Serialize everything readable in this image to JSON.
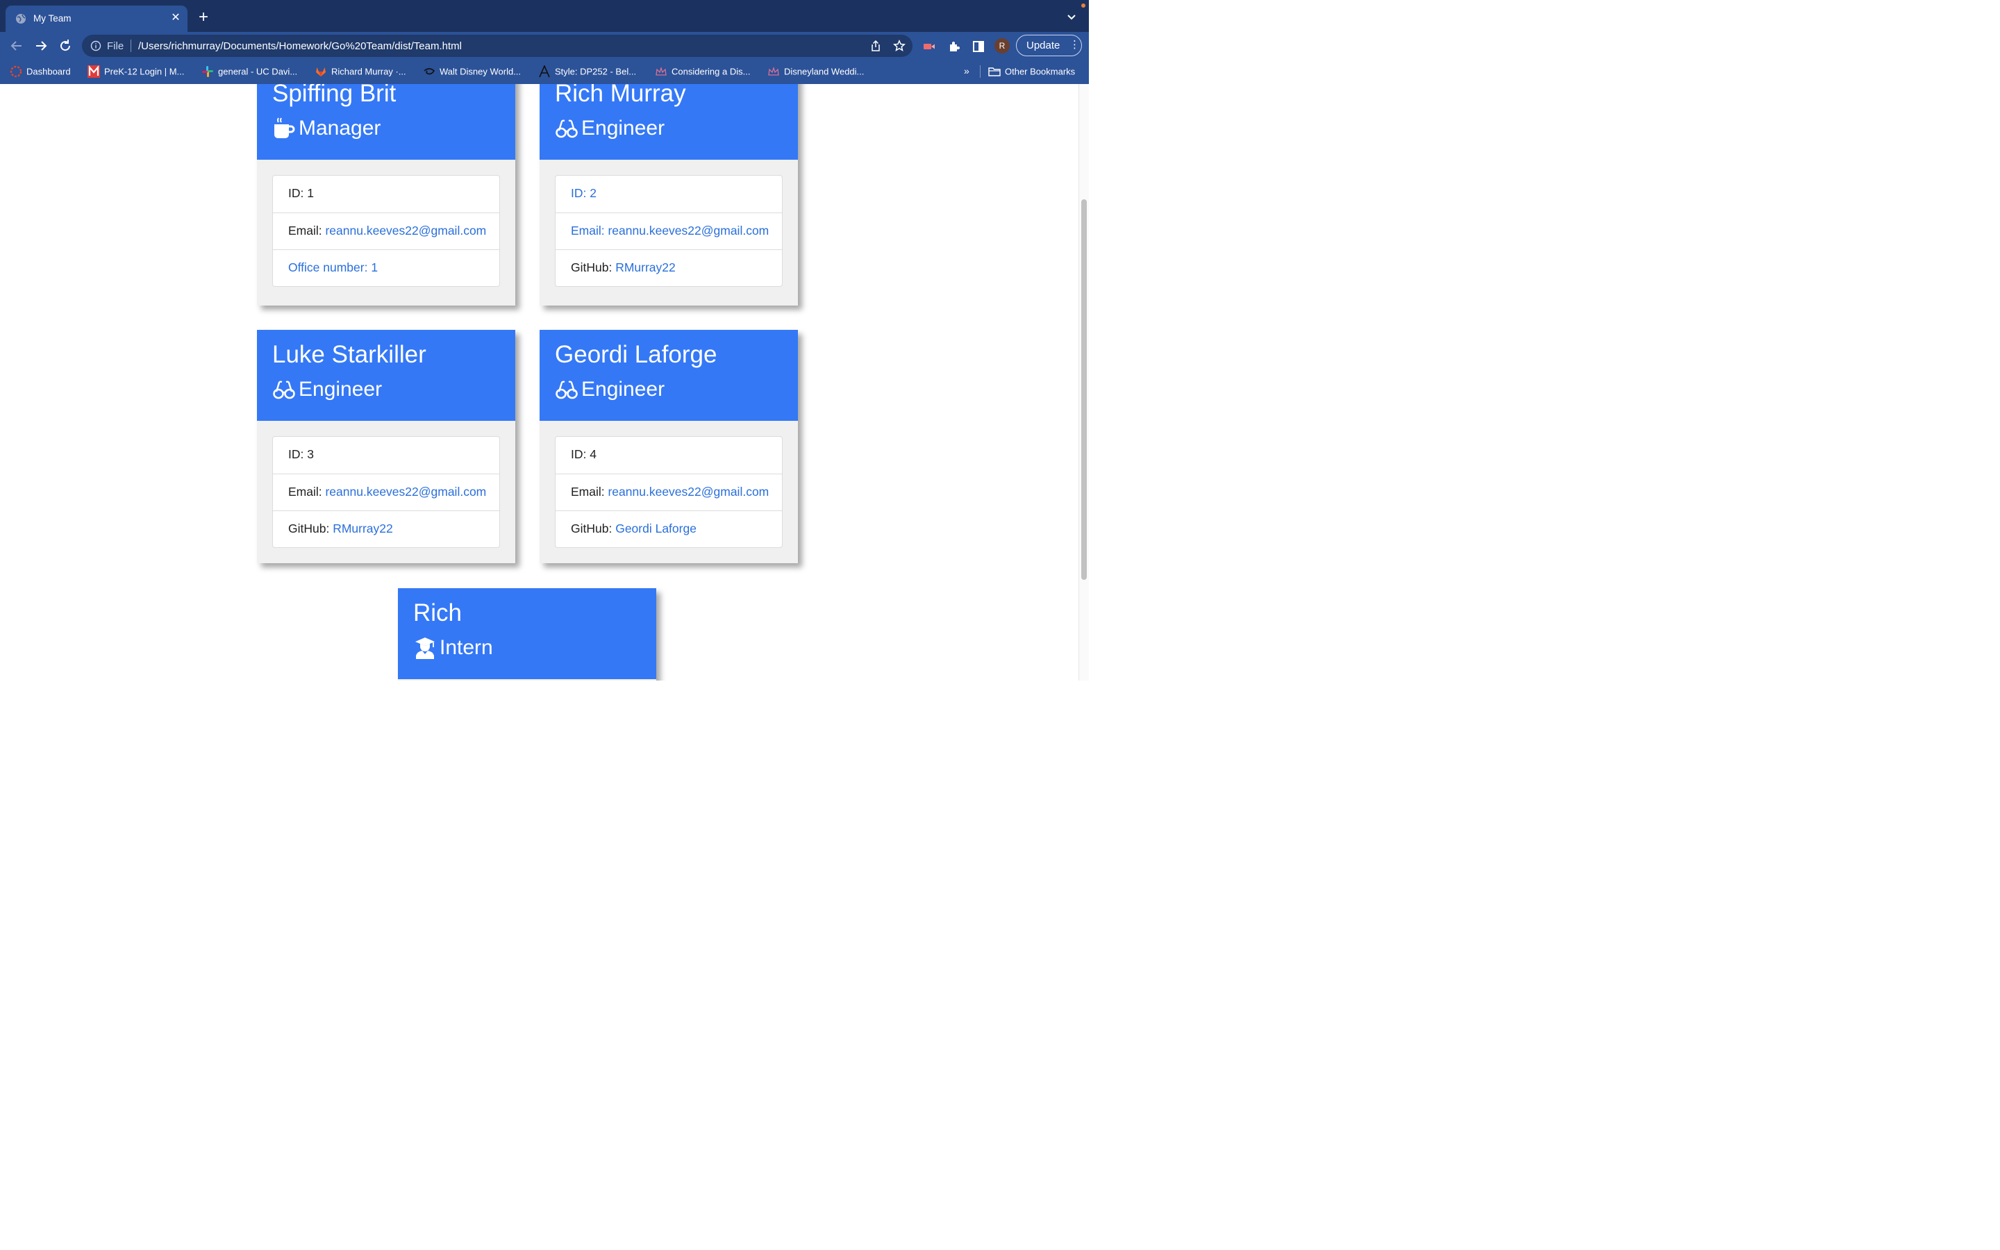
{
  "browser": {
    "tab_title": "My Team",
    "omnibox_scheme": "File",
    "url": "/Users/richmurray/Documents/Homework/Go%20Team/dist/Team.html",
    "profile_initial": "R",
    "update_label": "Update",
    "bookmarks": [
      {
        "label": "Dashboard",
        "icon": "canvas-icon"
      },
      {
        "label": "PreK-12 Login | M...",
        "icon": "m-logo-icon"
      },
      {
        "label": "general - UC Davi...",
        "icon": "slack-icon"
      },
      {
        "label": "Richard Murray ·...",
        "icon": "gitlab-icon"
      },
      {
        "label": "Walt Disney World...",
        "icon": "disney-icon"
      },
      {
        "label": "Style: DP252 - Bel...",
        "icon": "font-a-icon"
      },
      {
        "label": "Considering a Dis...",
        "icon": "crown-icon"
      },
      {
        "label": "Disneyland Weddi...",
        "icon": "crown-icon"
      }
    ],
    "bookmarks_more": "»",
    "other_bookmarks": "Other Bookmarks"
  },
  "team": [
    {
      "name": "Spiffing Brit",
      "role": "Manager",
      "role_icon": "coffee-mug-icon",
      "id_label": "ID: 1",
      "email_key": "Email: ",
      "email": "reannu.keeves22@gmail.com",
      "extra_label": "Office number: 1"
    },
    {
      "name": "Rich Murray",
      "role": "Engineer",
      "role_icon": "glasses-icon",
      "id_label": "ID: 2",
      "email_label": "Email: reannu.keeves22@gmail.com",
      "extra_key": "GitHub: ",
      "extra_value": "RMurray22"
    },
    {
      "name": "Luke Starkiller",
      "role": "Engineer",
      "role_icon": "glasses-icon",
      "id_label": "ID: 3",
      "email_key": "Email: ",
      "email": "reannu.keeves22@gmail.com",
      "extra_key": "GitHub: ",
      "extra_value": "RMurray22"
    },
    {
      "name": "Geordi Laforge",
      "role": "Engineer",
      "role_icon": "glasses-icon",
      "id_label": "ID: 4",
      "email_key": "Email: ",
      "email": "reannu.keeves22@gmail.com",
      "extra_key": "GitHub: ",
      "extra_value": "Geordi Laforge"
    },
    {
      "name": "Rich",
      "role": "Intern",
      "role_icon": "graduate-icon"
    }
  ],
  "colors": {
    "card_header": "#3478f6",
    "link": "#2a6fdb",
    "chrome_dark": "#1b3260",
    "chrome": "#2c5298"
  }
}
